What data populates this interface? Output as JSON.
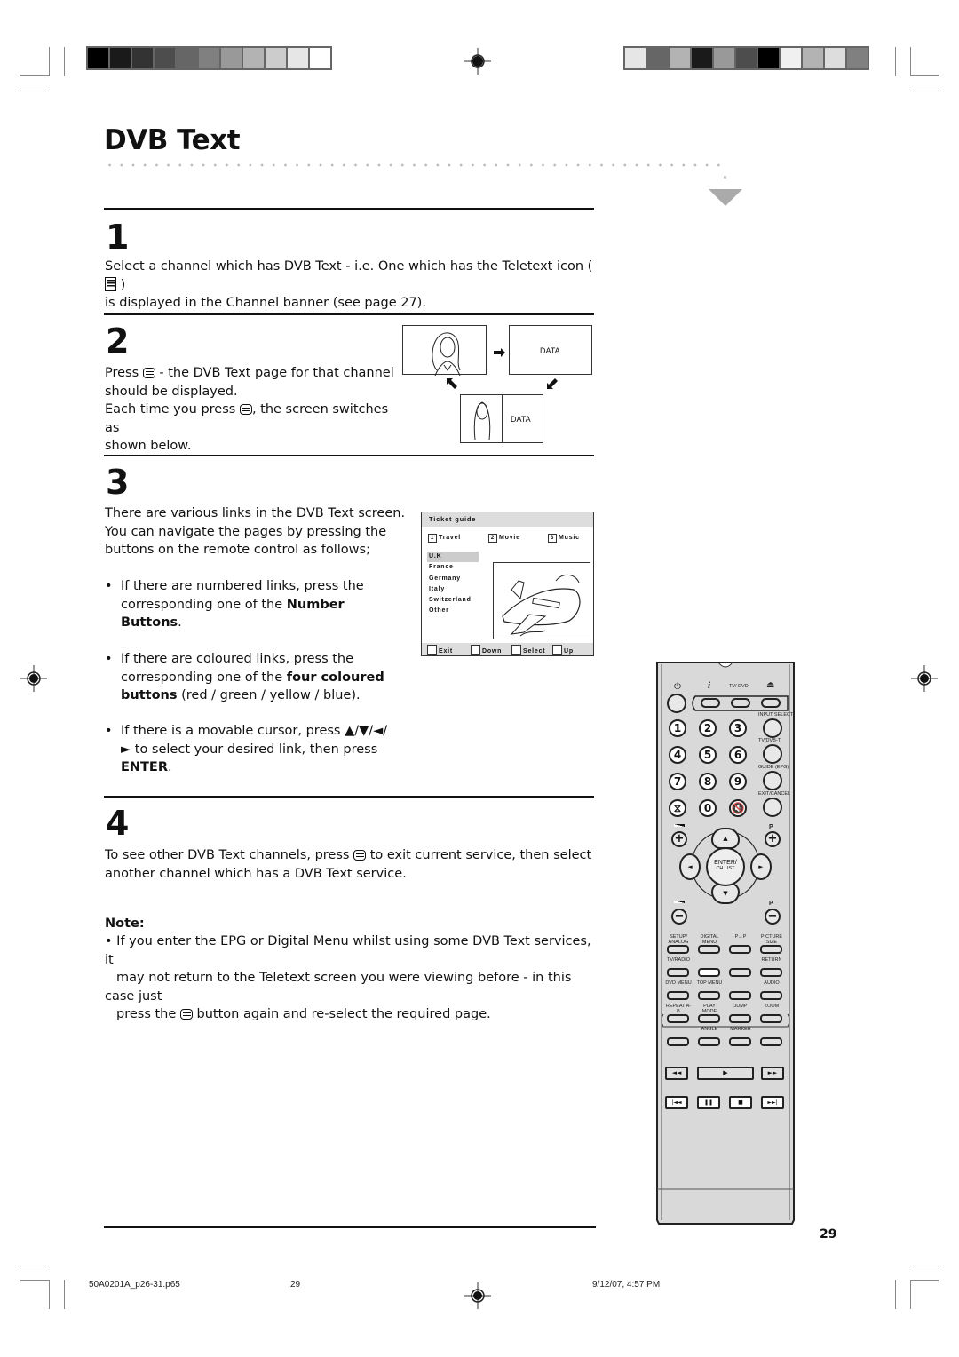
{
  "print_marks": {
    "swatches_left": [
      "#000000",
      "#1a1a1a",
      "#333333",
      "#4d4d4d",
      "#666666",
      "#808080",
      "#999999",
      "#b3b3b3",
      "#cccccc",
      "#e6e6e6",
      "#ffffff"
    ],
    "swatches_right": [
      "#e6e6e6",
      "#666666",
      "#b3b3b3",
      "#1a1a1a",
      "#999999",
      "#4d4d4d",
      "#000000",
      "#f0f0f0",
      "#b3b3b3",
      "#dddddd",
      "#808080"
    ]
  },
  "page": {
    "title": "DVB Text",
    "page_number": "29"
  },
  "steps": [
    {
      "number": "1",
      "text_a": "Select a channel which has DVB Text - i.e. One which has the Teletext icon (",
      "text_b": ")",
      "text_c": "is displayed in the Channel banner (see page 27)."
    },
    {
      "number": "2",
      "line1_a": "Press",
      "line1_b": "- the DVB Text page for that channel",
      "line2": "should be displayed.",
      "line3_a": "Each time you press",
      "line3_b": ", the screen switches as",
      "line4": "shown below.",
      "diagram": {
        "data_label": "DATA"
      }
    },
    {
      "number": "3",
      "intro": [
        "There are various links in the DVB Text screen.",
        "You can navigate the pages by pressing the",
        "buttons on the remote control as follows;"
      ],
      "bullet1_a": "If there are numbered links, press the",
      "bullet1_b": "corresponding one of the",
      "bullet1_bold": "Number",
      "bullet1_bold2": "Buttons",
      "bullet1_end": ".",
      "bullet2_a": "If there are coloured links, press the",
      "bullet2_b": "corresponding one of the",
      "bullet2_bold": "four coloured",
      "bullet2_bold2": "buttons",
      "bullet2_end": "(red / green / yellow / blue).",
      "bullet3_a": "If there is a movable cursor, press ▲/▼/◄/",
      "bullet3_b": "► to select your desired link, then press",
      "bullet3_bold": "ENTER",
      "bullet3_end": "."
    },
    {
      "number": "4",
      "line1_a": "To see other DVB Text channels, press",
      "line1_b": "to exit current service, then select",
      "line2": "another channel which has a DVB Text service."
    }
  ],
  "ticket_guide": {
    "title": "Ticket guide",
    "tabs": [
      {
        "num": "1",
        "label": "Travel"
      },
      {
        "num": "2",
        "label": "Movie"
      },
      {
        "num": "3",
        "label": "Music"
      }
    ],
    "countries": [
      "U.K",
      "France",
      "Germany",
      "Italy",
      "Switzerland",
      "Other"
    ],
    "selected_country": "U.K",
    "footer": [
      "Exit",
      "Down",
      "Select",
      "Up"
    ]
  },
  "note": {
    "heading": "Note:",
    "line1": "• If you enter the EPG or Digital Menu whilst using some DVB Text services, it",
    "line2": "may not return to the Teletext screen you were viewing before - in this case just",
    "line3_a": "press the",
    "line3_b": "button again and re-select the required page."
  },
  "remote": {
    "top_labels": {
      "power": "⏻",
      "info": "i",
      "tvdvd": "TV/ DVD",
      "eject": "⏏"
    },
    "digits": [
      "1",
      "2",
      "3",
      "4",
      "5",
      "6",
      "7",
      "8",
      "9",
      "⧖",
      "0",
      "🔇"
    ],
    "side_labels": [
      "INPUT SELECT",
      "TV/DVB-T",
      "GUIDE (EPG)",
      "EXIT/CANCEL"
    ],
    "vol_plus": "+",
    "vol_minus": "−",
    "p_label": "P",
    "p_plus": "+",
    "p_minus": "−",
    "enter_label": "ENTER/",
    "chlist_label": "CH LIST",
    "up": "▲",
    "down": "▼",
    "left": "◄",
    "right": "►",
    "menu_labels": [
      [
        "SETUP/ ANALOG MENU",
        "DIGITAL MENU",
        "P↔P",
        "PICTURE SIZE"
      ],
      [
        "TV/RADIO",
        "",
        "",
        "RETURN"
      ],
      [
        "DVD MENU",
        "TOP MENU",
        "",
        "AUDIO"
      ],
      [
        "REPEAT A-B",
        "PLAY MODE",
        "JUMP",
        "ZOOM"
      ],
      [
        "",
        "ANGLE",
        "MARKER",
        ""
      ]
    ],
    "transport1": [
      "◄◄",
      "▶",
      "►►"
    ],
    "transport2": [
      "|◄◄",
      "❚❚",
      "■",
      "►►|"
    ]
  },
  "footer": {
    "file": "50A0201A_p26-31.p65",
    "page": "29",
    "timestamp": "9/12/07, 4:57 PM"
  }
}
